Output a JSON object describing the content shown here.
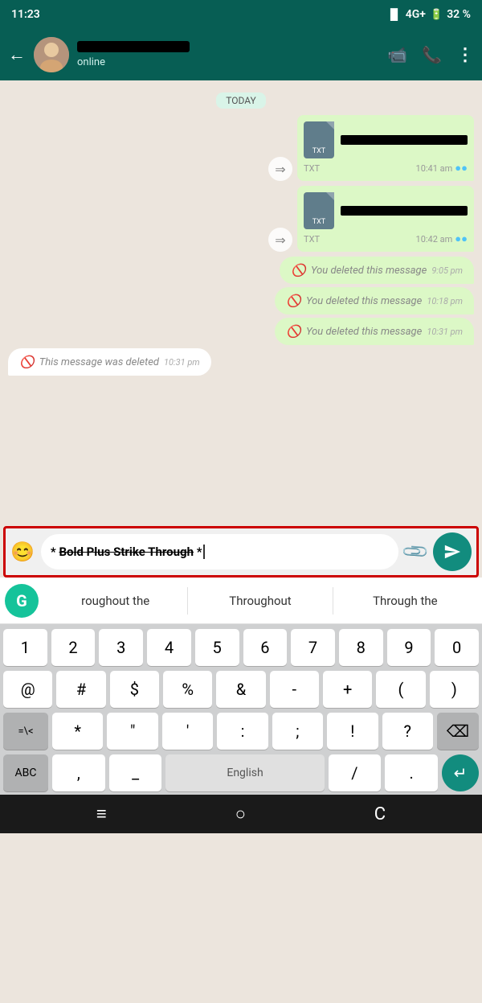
{
  "statusBar": {
    "time": "11:23",
    "signal": "4G+",
    "battery": "32 %"
  },
  "header": {
    "backLabel": "←",
    "statusText": "online",
    "icons": {
      "video": "📹",
      "phone": "📞",
      "more": "⋮"
    }
  },
  "chat": {
    "dateDivider": "TODAY",
    "messages": [
      {
        "type": "outgoing-file",
        "fileType": "TXT",
        "time": "10:41 am",
        "redacted": true
      },
      {
        "type": "outgoing-file",
        "fileType": "TXT",
        "time": "10:42 am",
        "redacted": true
      },
      {
        "type": "outgoing-deleted",
        "text": "You deleted this message",
        "time": "9:05 pm"
      },
      {
        "type": "outgoing-deleted",
        "text": "You deleted this message",
        "time": "10:18 pm"
      },
      {
        "type": "outgoing-deleted",
        "text": "You deleted this message",
        "time": "10:31 pm"
      },
      {
        "type": "incoming-deleted",
        "text": "This message was deleted",
        "time": "10:31 pm"
      }
    ]
  },
  "inputArea": {
    "emojiIcon": "😊",
    "textPrefix": "* ",
    "textBoldStrike": "Bold Plus Strike Through",
    "textSuffix": " *",
    "attachIcon": "📎",
    "sendArrow": "➤"
  },
  "autocomplete": {
    "grammarlyLetter": "G",
    "items": [
      "roughout the",
      "Throughout",
      "Through the"
    ]
  },
  "keyboard": {
    "row1": [
      "1",
      "2",
      "3",
      "4",
      "5",
      "6",
      "7",
      "8",
      "9",
      "0"
    ],
    "row2": [
      "@",
      "#",
      "$",
      "%",
      "&",
      "-",
      "+",
      "(",
      ")"
    ],
    "row3": [
      "=\\<",
      "*",
      "\"",
      "'",
      ":",
      ";",
      "!",
      "?",
      "⌫"
    ],
    "bottomLeft": "ABC",
    "comma": ",",
    "underscore": "_",
    "spaceLabel": "English",
    "slash": "/",
    "dot": ".",
    "enterIcon": "↵"
  },
  "navBar": {
    "icons": [
      "≡",
      "○",
      "C"
    ]
  }
}
